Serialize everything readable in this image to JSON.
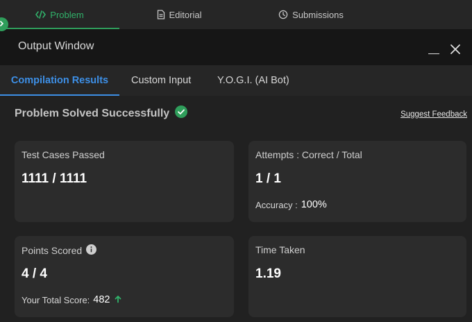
{
  "top_tabs": [
    {
      "label": "Problem",
      "icon": "code-icon",
      "active": true
    },
    {
      "label": "Editorial",
      "icon": "document-icon",
      "active": false
    },
    {
      "label": "Submissions",
      "icon": "clock-icon",
      "active": false
    }
  ],
  "output_window": {
    "title": "Output Window",
    "tabs": [
      {
        "label": "Compilation Results",
        "active": true
      },
      {
        "label": "Custom Input",
        "active": false
      },
      {
        "label": "Y.O.G.I. (AI Bot)",
        "active": false
      }
    ],
    "status": "Problem Solved Successfully",
    "feedback_link": "Suggest Feedback"
  },
  "cards": {
    "test_cases": {
      "label": "Test Cases Passed",
      "value": "1111 / 1111"
    },
    "attempts": {
      "label": "Attempts : Correct / Total",
      "value": "1 / 1",
      "sub_label": "Accuracy :",
      "sub_value": "100%"
    },
    "points": {
      "label": "Points Scored",
      "value": "4 / 4",
      "sub_label": "Your Total Score:",
      "sub_value": "482"
    },
    "time": {
      "label": "Time Taken",
      "value": "1.19"
    }
  },
  "colors": {
    "accent_green": "#2f9e5b",
    "accent_blue": "#3d8fe6",
    "background": "#212121",
    "card": "#2c2c2c"
  }
}
